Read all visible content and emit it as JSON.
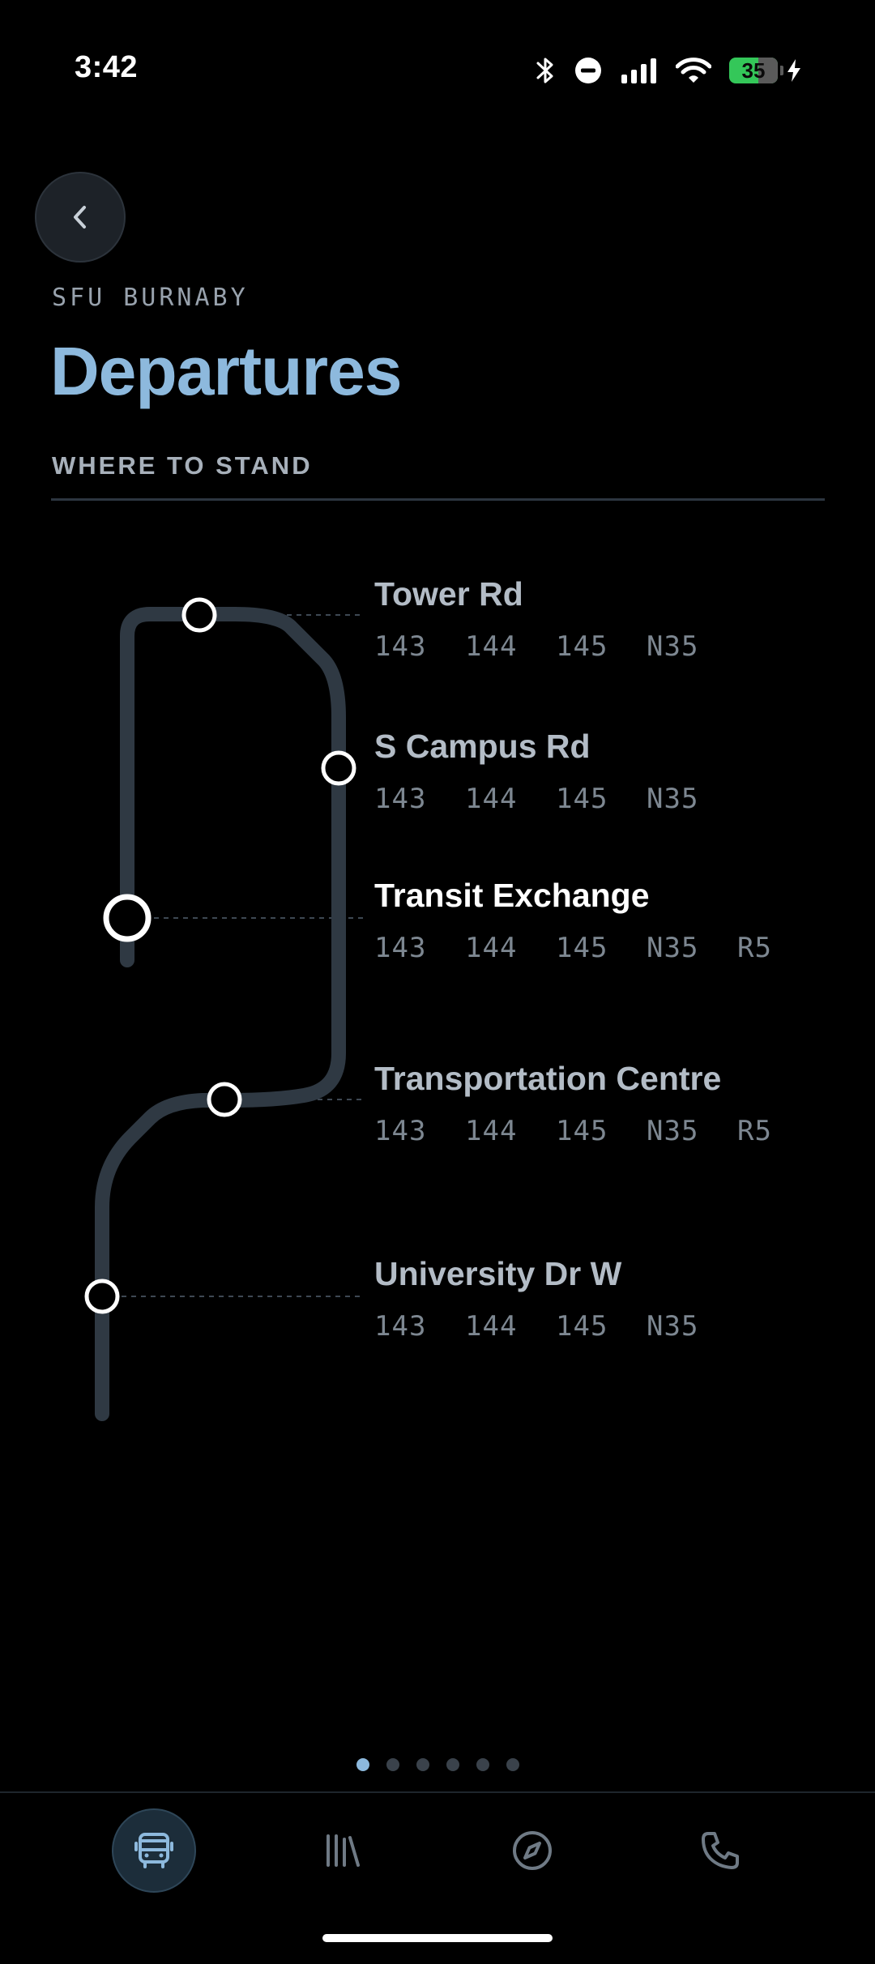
{
  "status_bar": {
    "time": "3:42",
    "battery_level": "35",
    "icons": [
      "bluetooth-icon",
      "do-not-disturb-icon",
      "cellular-signal-icon",
      "wifi-icon",
      "battery-icon",
      "charging-bolt-icon"
    ]
  },
  "header": {
    "back_icon": "chevron-left-icon",
    "subtitle": "SFU BURNABY",
    "title": "Departures",
    "section_heading": "WHERE TO STAND"
  },
  "stops": [
    {
      "name": "Tower Rd",
      "routes": [
        "143",
        "144",
        "145",
        "N35"
      ],
      "current": false
    },
    {
      "name": "S Campus Rd",
      "routes": [
        "143",
        "144",
        "145",
        "N35"
      ],
      "current": false
    },
    {
      "name": "Transit Exchange",
      "routes": [
        "143",
        "144",
        "145",
        "N35",
        "R5"
      ],
      "current": true
    },
    {
      "name": "Transportation Centre",
      "routes": [
        "143",
        "144",
        "145",
        "N35",
        "R5"
      ],
      "current": false
    },
    {
      "name": "University Dr W",
      "routes": [
        "143",
        "144",
        "145",
        "N35"
      ],
      "current": false
    }
  ],
  "pagination": {
    "count": 6,
    "active_index": 0
  },
  "bottom_nav": {
    "items": [
      {
        "icon": "bus-icon",
        "active": true
      },
      {
        "icon": "library-icon",
        "active": false
      },
      {
        "icon": "compass-icon",
        "active": false
      },
      {
        "icon": "phone-icon",
        "active": false
      }
    ]
  },
  "colors": {
    "accent": "#8db9dd",
    "route_line": "#2f3943",
    "background": "#000000"
  }
}
